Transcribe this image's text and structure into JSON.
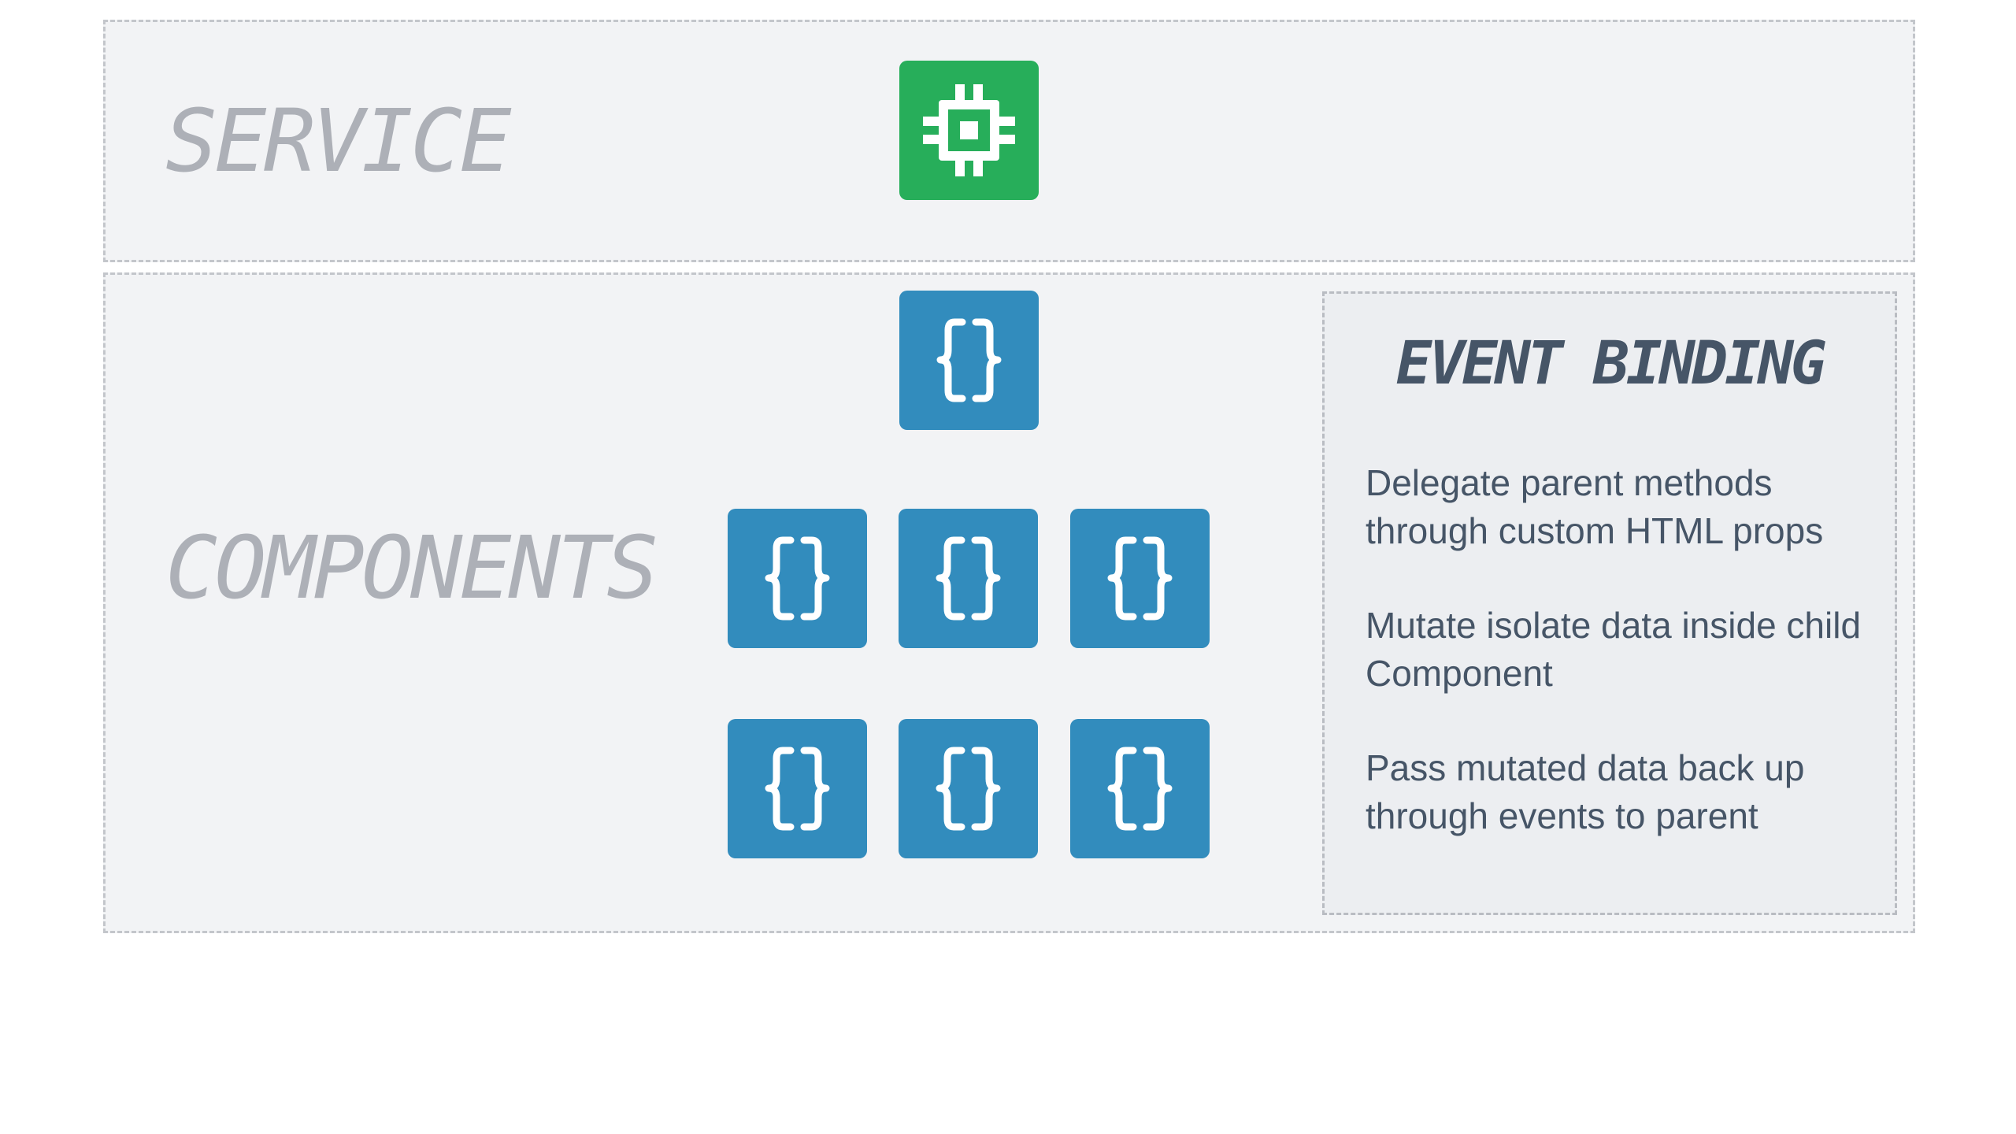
{
  "service_band": {
    "label": "SERVICE"
  },
  "components_band": {
    "label": "COMPONENTS"
  },
  "info_panel": {
    "title": "EVENT BINDING",
    "points": [
      "Delegate parent methods through custom HTML props",
      "Mutate isolate data inside child Component",
      "Pass mutated data back up through events to parent"
    ]
  },
  "icons": {
    "service": "chip-icon",
    "component": "curly-braces-icon"
  },
  "colors": {
    "band_background": "#f2f3f5",
    "panel_background": "#eceef1",
    "service_tile": "#27ae5a",
    "component_tile": "#328cbd",
    "label_gray": "#adb0b7",
    "panel_text": "#465567"
  }
}
